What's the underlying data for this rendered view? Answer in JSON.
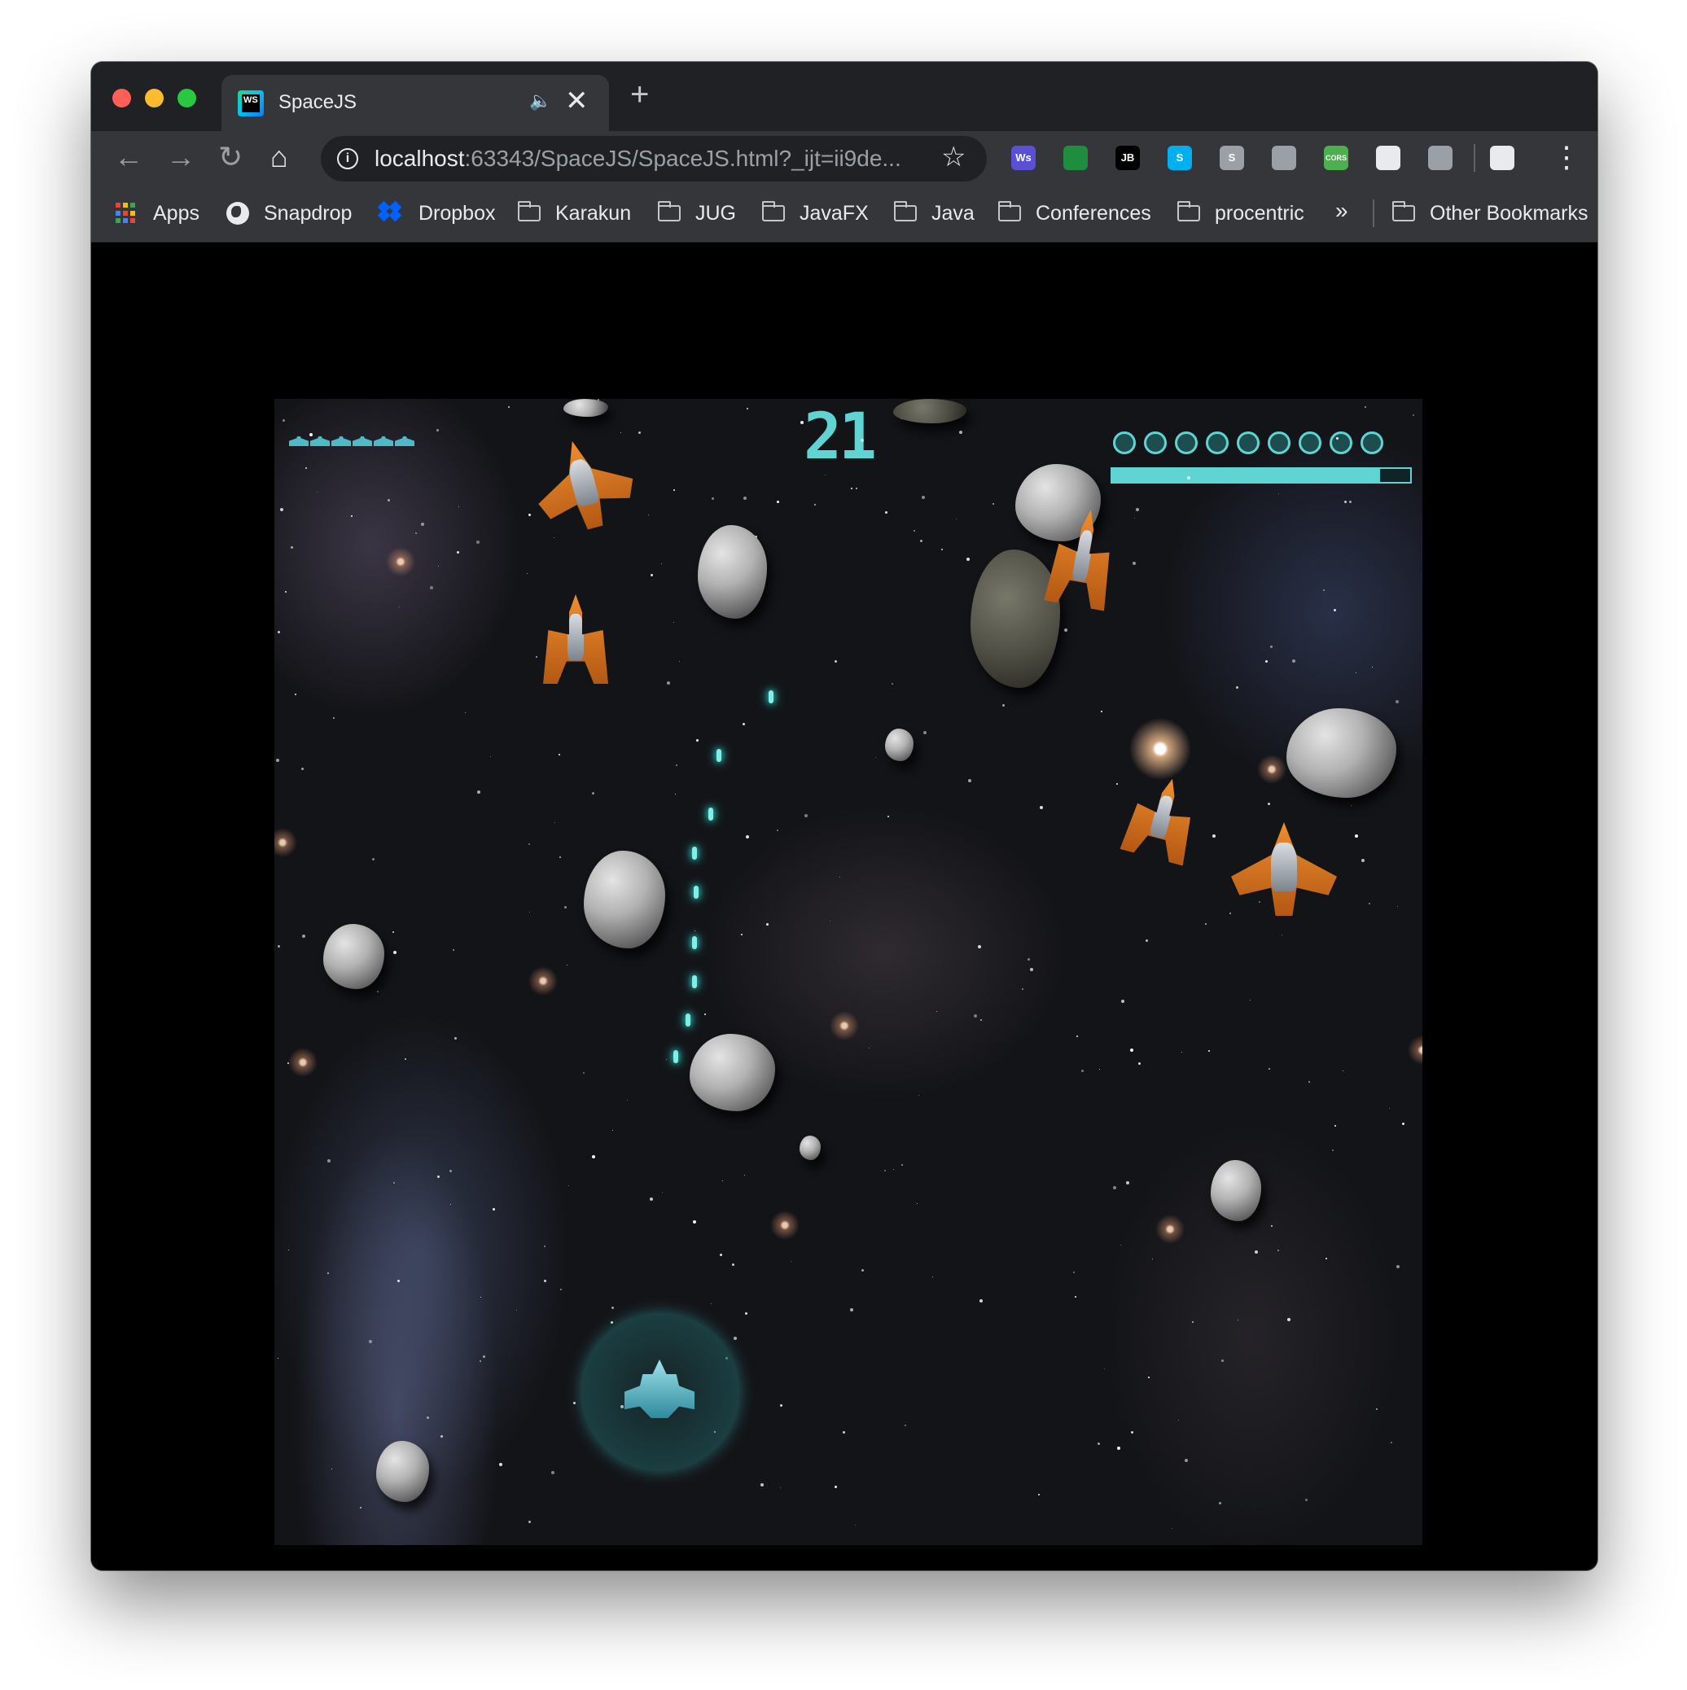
{
  "browser": {
    "tab": {
      "title": "SpaceJS",
      "audio_icon": "speaker-icon",
      "close_glyph": "✕"
    },
    "new_tab_glyph": "+",
    "toolbar": {
      "back_glyph": "←",
      "forward_glyph": "→",
      "reload_glyph": "↻",
      "home_glyph": "⌂",
      "url_host": "localhost",
      "url_rest": ":63343/SpaceJS/SpaceJS.html?_ijt=ii9de...",
      "star_glyph": "☆",
      "menu_glyph": "⋮",
      "extensions": [
        {
          "name": "ws-extension-icon",
          "label": "Ws",
          "color": "#5b4fd6"
        },
        {
          "name": "screenshot-extension-icon",
          "label": "",
          "color": "#1e8e3e"
        },
        {
          "name": "jetbrains-extension-icon",
          "label": "JB",
          "color": "#000000"
        },
        {
          "name": "skype-extension-icon",
          "label": "S",
          "color": "#00aff0"
        },
        {
          "name": "s-extension-icon",
          "label": "S",
          "color": "#9aa0a6"
        },
        {
          "name": "shield-extension-icon",
          "label": "",
          "color": "#9aa0a6"
        },
        {
          "name": "cors-extension-icon",
          "label": "CORS",
          "color": "#4caf50"
        },
        {
          "name": "record-extension-icon",
          "label": "",
          "color": "#e8eaed"
        },
        {
          "name": "camera-extension-icon",
          "label": "",
          "color": "#9aa0a6"
        },
        {
          "name": "profile-extension-icon",
          "label": "",
          "color": "#e8eaed"
        }
      ]
    },
    "bookmarks": {
      "items": [
        {
          "label": "Apps",
          "icon": "apps-icon"
        },
        {
          "label": "Snapdrop",
          "icon": "globe-icon"
        },
        {
          "label": "Dropbox",
          "icon": "dropbox-icon"
        },
        {
          "label": "Karakun",
          "icon": "folder-icon"
        },
        {
          "label": "JUG",
          "icon": "folder-icon"
        },
        {
          "label": "JavaFX",
          "icon": "folder-icon"
        },
        {
          "label": "Java",
          "icon": "folder-icon"
        },
        {
          "label": "Conferences",
          "icon": "folder-icon"
        },
        {
          "label": "procentric",
          "icon": "folder-icon"
        }
      ],
      "overflow_glyph": "»",
      "other": "Other Bookmarks"
    }
  },
  "game": {
    "score": "21",
    "lives": 6,
    "shields": 9,
    "energy_fraction": 0.9,
    "colors": {
      "hud": "#5fd4d2",
      "enemy": "#f08d2e",
      "laser": "#7ff0e8"
    }
  }
}
